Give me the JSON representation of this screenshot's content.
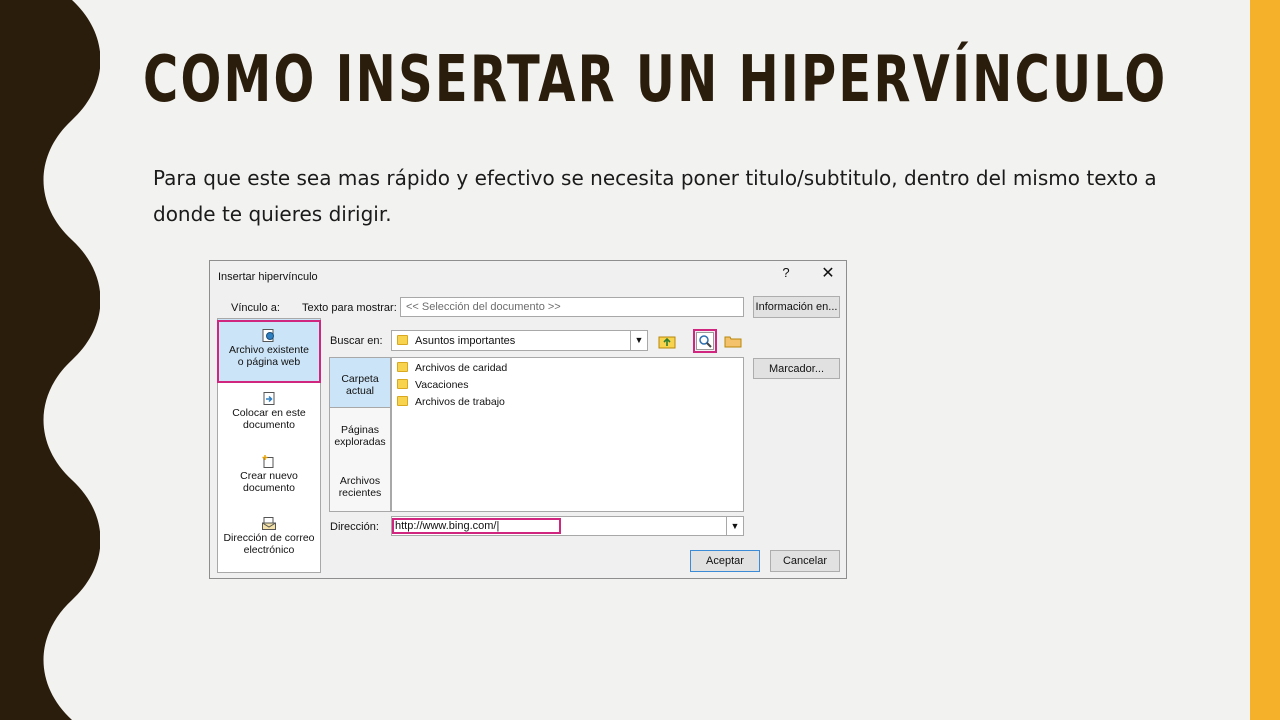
{
  "slide": {
    "title": "COMO INSERTAR UN HIPERVÍNCULO",
    "body": "Para que este sea mas rápido y efectivo se necesita poner titulo/subtitulo, dentro del mismo texto a donde te quieres dirigir."
  },
  "colors": {
    "left_wave": "#2b1d0c",
    "right_bar": "#f6b12a",
    "title": "#2b1d0c",
    "highlight": "#d1267f",
    "selected": "#cce4f7"
  },
  "dialog": {
    "title": "Insertar hipervínculo",
    "help": "?",
    "close": "✕",
    "link_to_label": "Vínculo a:",
    "text_to_display_label": "Texto para mostrar:",
    "text_to_display_value": "<< Selección del documento >>",
    "screentip_button": "Información en...",
    "look_in_label": "Buscar en:",
    "look_in_value": "Asuntos importantes",
    "bookmark_button": "Marcador...",
    "address_label": "Dirección:",
    "address_value": "http://www.bing.com/|",
    "ok_button": "Aceptar",
    "cancel_button": "Cancelar",
    "link_options": [
      {
        "line1": "Archivo existente",
        "line2": "o página web",
        "icon": "web-page-icon",
        "selected": true
      },
      {
        "line1": "Colocar en este",
        "line2": "documento",
        "icon": "place-in-document-icon"
      },
      {
        "line1": "Crear nuevo",
        "line2": "documento",
        "icon": "new-document-icon"
      },
      {
        "line1": "Dirección de correo",
        "line2": "electrónico",
        "icon": "email-address-icon"
      }
    ],
    "tabs": [
      {
        "line1": "Carpeta",
        "line2": "actual",
        "selected": true
      },
      {
        "line1": "Páginas",
        "line2": "exploradas"
      },
      {
        "line1": "Archivos",
        "line2": "recientes"
      }
    ],
    "files": [
      "Archivos de caridad",
      "Vacaciones",
      "Archivos de trabajo"
    ],
    "toolbar_icons": [
      "up-folder-icon",
      "browse-web-icon",
      "browse-file-icon"
    ]
  }
}
